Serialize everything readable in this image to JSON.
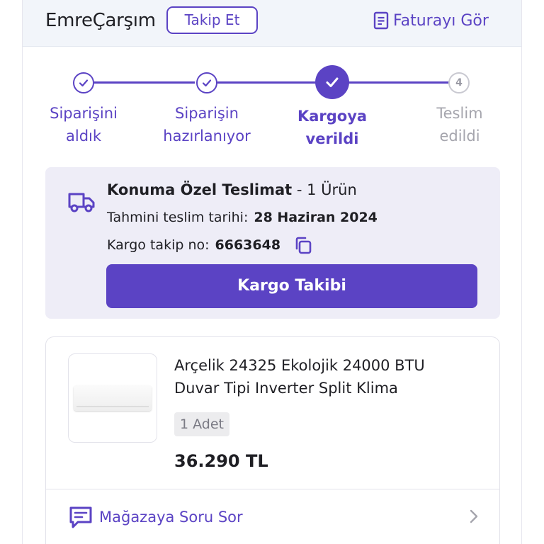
{
  "header": {
    "store_name": "EmreÇarşım",
    "follow_label": "Takip Et",
    "invoice_label": "Faturayı Gör"
  },
  "stepper": {
    "steps": [
      {
        "line1": "Siparişini",
        "line2": "aldık",
        "state": "done"
      },
      {
        "line1": "Siparişin",
        "line2": "hazırlanıyor",
        "state": "done"
      },
      {
        "line1": "Kargoya",
        "line2": "verildi",
        "state": "active"
      },
      {
        "line1": "Teslim",
        "line2": "edildi",
        "state": "todo",
        "number": "4"
      }
    ]
  },
  "shipment": {
    "title_bold": "Konuma Özel Teslimat",
    "title_suffix": " - 1 Ürün",
    "eta_label": "Tahmini teslim tarihi:",
    "eta_value": "28 Haziran 2024",
    "tracking_label": "Kargo takip no:",
    "tracking_value": "6663648",
    "track_button": "Kargo Takibi"
  },
  "product": {
    "name": "Arçelik 24325 Ekolojik 24000 BTU Duvar Tipi Inverter Split Klima",
    "quantity": "1 Adet",
    "price": "36.290 TL",
    "ask_label": "Mağazaya Soru Sor"
  },
  "colors": {
    "accent": "#5b43c4",
    "header_bg": "#f2f5fa",
    "ship_bg": "#eeedf7",
    "inactive": "#a5a5ad"
  }
}
